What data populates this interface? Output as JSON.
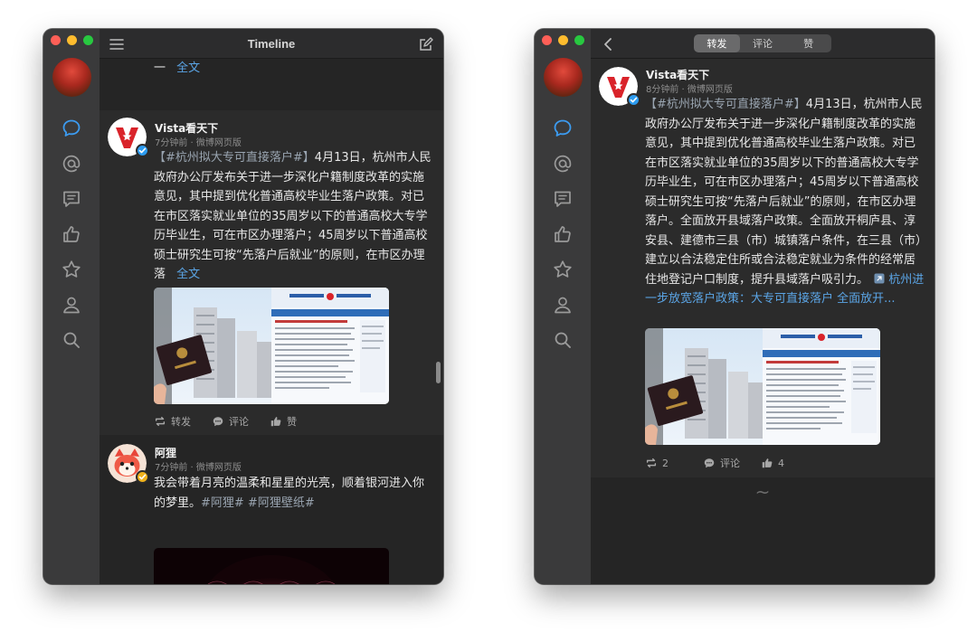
{
  "colors": {
    "accent_link": "#5ba5e6",
    "sidebar_active": "#3c9bf0",
    "window_bg": "#252525"
  },
  "left": {
    "title": "Timeline",
    "partial_post": {
      "tail_text": "一",
      "more_link": "全文",
      "repost_label": "转发",
      "comment_label": "评论",
      "like_label": "赞"
    },
    "post1": {
      "username": "Vista看天下",
      "meta": "7分钟前 · 微博网页版",
      "hashtag": "【#杭州拟大专可直接落户#】",
      "text": "4月13日，杭州市人民政府办公厅发布关于进一步深化户籍制度改革的实施意见，其中提到优化普通高校毕业生落户政策。对已在市区落实就业单位的35周岁以下的普通高校大专学历毕业生，可在市区办理落户；45周岁以下普通高校硕士研究生可按“先落户后就业”的原则，在市区办理落",
      "more_link": "全文",
      "repost_label": "转发",
      "comment_label": "评论",
      "like_label": "赞"
    },
    "post2": {
      "username": "阿狸",
      "meta": "7分钟前 · 微博网页版",
      "text": "我会带着月亮的温柔和星星的光亮，顺着银河进入你的梦里。",
      "tags": "#阿狸# #阿狸壁纸#"
    }
  },
  "right": {
    "tabs": [
      "转发",
      "评论",
      "赞"
    ],
    "active_tab": 0,
    "post": {
      "username": "Vista看天下",
      "meta": "8分钟前 · 微博网页版",
      "hashtag": "【#杭州拟大专可直接落户#】",
      "text": "4月13日，杭州市人民政府办公厅发布关于进一步深化户籍制度改革的实施意见，其中提到优化普通高校毕业生落户政策。对已在市区落实就业单位的35周岁以下的普通高校大专学历毕业生，可在市区办理落户；45周岁以下普通高校硕士研究生可按“先落户后就业”的原则，在市区办理落户。全面放开县域落户政策。全面放开桐庐县、淳安县、建德市三县（市）城镇落户条件，在三县（市）建立以合法稳定住所或合法稳定就业为条件的经常居住地登记户口制度，提升县域落户吸引力。",
      "link_text": "杭州进一步放宽落户政策：大专可直接落户 全面放开...",
      "repost_count": "2",
      "comment_label": "评论",
      "like_count": "4"
    },
    "footer": "~"
  }
}
